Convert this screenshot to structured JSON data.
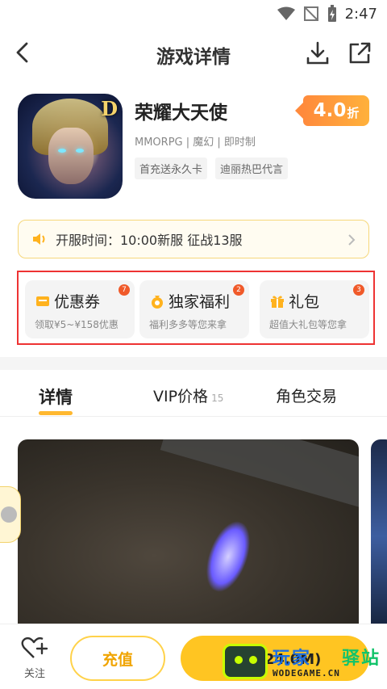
{
  "status_bar": {
    "time": "2:47"
  },
  "header": {
    "title": "游戏详情"
  },
  "game": {
    "name": "荣耀大天使",
    "tags": "MMORPG | 魔幻 | 即时制",
    "chips": [
      "首充送永久卡",
      "迪丽热巴代言"
    ],
    "discount_value": "4.0",
    "discount_unit": "折"
  },
  "server": {
    "text": "开服时间：10:00新服 征战13服"
  },
  "benefits": [
    {
      "title": "优惠券",
      "subtitle": "领取¥5~¥158优惠",
      "count": "7",
      "icon": "ticket-icon"
    },
    {
      "title": "独家福利",
      "subtitle": "福利多多等您来拿",
      "count": "2",
      "icon": "money-bag-icon"
    },
    {
      "title": "礼包",
      "subtitle": "超值大礼包等您拿",
      "count": "3",
      "icon": "gift-icon"
    }
  ],
  "tabs": [
    {
      "label": "详情",
      "count": ""
    },
    {
      "label": "VIP价格",
      "count": "15"
    },
    {
      "label": "角色交易",
      "count": ""
    }
  ],
  "bottom_bar": {
    "follow_label": "关注",
    "recharge_label": "充值",
    "download_label": "下载(24.0M)"
  },
  "watermark": {
    "brand_left": "玩家",
    "brand_right": "驿站",
    "domain": "WODEGAME.CN"
  },
  "colors": {
    "accent": "#ffc522",
    "discount": "#ff8a3c",
    "highlight_border": "#ee3333"
  }
}
